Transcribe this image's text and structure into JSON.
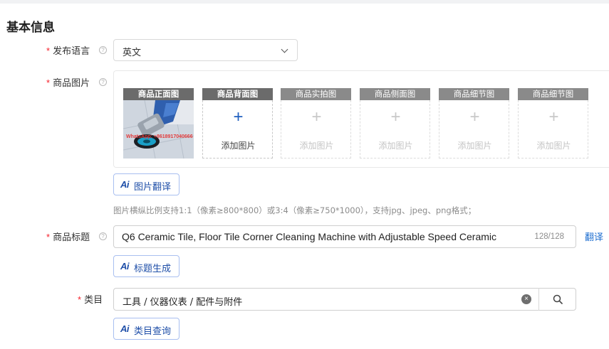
{
  "section_title": "基本信息",
  "required_mark": "*",
  "help_glyph": "?",
  "language": {
    "label": "发布语言",
    "value": "英文"
  },
  "images": {
    "label": "商品图片",
    "slots": [
      {
        "header": "商品正面图",
        "watermark": "WhatsApp: +8618917040666"
      },
      {
        "header": "商品背面图",
        "plus": "+",
        "caption": "添加图片"
      },
      {
        "header": "商品实拍图",
        "plus": "+",
        "caption": "添加图片"
      },
      {
        "header": "商品侧面图",
        "plus": "+",
        "caption": "添加图片"
      },
      {
        "header": "商品细节图",
        "plus": "+",
        "caption": "添加图片"
      },
      {
        "header": "商品细节图",
        "plus": "+",
        "caption": "添加图片"
      }
    ],
    "ai_mark": "Ai",
    "translate_button": "图片翻译",
    "hint": "图片横纵比例支持1:1（像素≥800*800）或3:4（像素≥750*1000），支持jpg、jpeg、png格式；"
  },
  "title": {
    "label": "商品标题",
    "value": "Q6 Ceramic Tile, Floor Tile Corner Cleaning Machine with Adjustable Speed Ceramic",
    "count": "128/128",
    "translate_link": "翻译",
    "generate_button": "标题生成"
  },
  "category": {
    "label": "类目",
    "value": "工具 / 仪器仪表 / 配件与附件",
    "clear_glyph": "×",
    "query_button": "类目查询"
  },
  "colors": {
    "required": "#f5222d",
    "link": "#1f6fd0",
    "ai_button_border": "#a9bff0",
    "ai_text": "#1f4fa8"
  }
}
